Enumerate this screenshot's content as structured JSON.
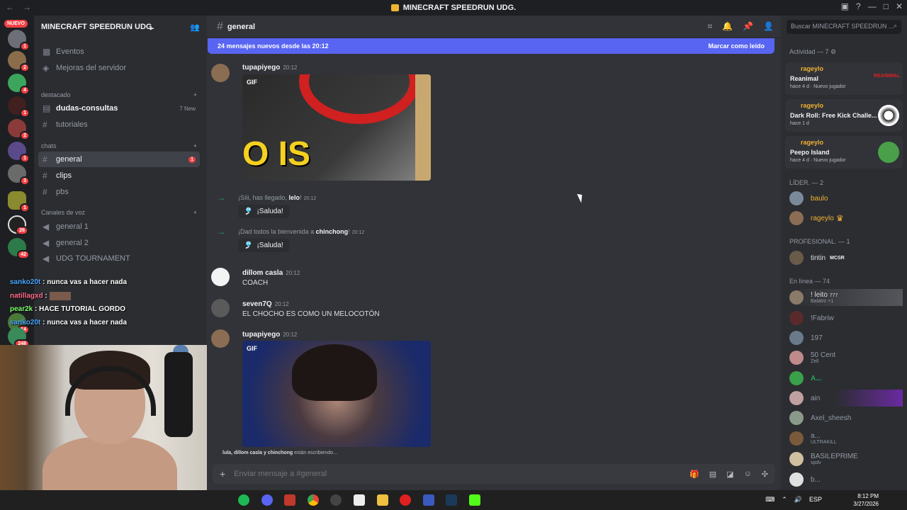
{
  "window": {
    "title": "MINECRAFT SPEEDRUN UDG.",
    "back": "←",
    "forward": "→"
  },
  "servers": {
    "nuevo": "NUEVO",
    "badges": [
      "1",
      "2",
      "4",
      "1",
      "2",
      "1",
      "3",
      "1",
      "26",
      "42",
      "14",
      "248"
    ]
  },
  "sidebar": {
    "server_name": "MINECRAFT SPEEDRUN UDG.",
    "items": [
      {
        "label": "Eventos"
      },
      {
        "label": "Mejoras del servidor"
      }
    ],
    "cat_destacado": "destacado",
    "destacado": [
      {
        "label": "dudas-consultas",
        "tag": "7 New"
      },
      {
        "label": "tutoriales"
      }
    ],
    "cat_chats": "chats",
    "chats": [
      {
        "label": "general",
        "badge": "1"
      },
      {
        "label": "clips"
      },
      {
        "label": "pbs"
      }
    ],
    "cat_voz": "Canales de voz",
    "voice": [
      {
        "label": "general 1"
      },
      {
        "label": "general 2"
      },
      {
        "label": "UDG TOURNAMENT"
      }
    ]
  },
  "twitch_chat": [
    {
      "user": "sanko20t",
      "text": ": nunca vas a hacer nada"
    },
    {
      "user": "natillagxd",
      "text": ":"
    },
    {
      "user": "pear2k",
      "text": ": HACE TUTORIAL GORDO"
    },
    {
      "user": "sanko20t",
      "text": ": nunca vas a hacer nada"
    }
  ],
  "chat": {
    "channel": "general",
    "banner_text": "24 mensajes nuevos desde las 20:12",
    "banner_action": "Marcar como leído",
    "messages": [
      {
        "author": "tupapiyego",
        "time": "20:12",
        "gif": "GIF",
        "gif_text": "O IS"
      },
      {
        "pre": "¡Síii, has llegado, ",
        "user": "lelo",
        "post": "!",
        "time": "20:12",
        "button": "¡Saluda!"
      },
      {
        "pre": "¡Dad todos la bienvenida a ",
        "user": "chinchong",
        "post": "!",
        "time": "20:12",
        "button": "¡Saluda!"
      },
      {
        "author": "dillom casla",
        "time": "20:12",
        "text": "COACH"
      },
      {
        "author": "seven7Q",
        "time": "20:12",
        "text": "EL CHOCHO ES COMO UN MELOCOTÓN"
      },
      {
        "author": "tupapiyego",
        "time": "20:12",
        "gif": "GIF"
      }
    ],
    "typing_users": "lula, dillom casla y chinchong",
    "typing_suffix": " están escribiendo...",
    "input_placeholder": "Enviar mensaje a #general"
  },
  "members": {
    "search_placeholder": "Buscar MINECRAFT SPEEDRUN ...",
    "activity_label": "Actividad — 7",
    "activities": [
      {
        "user": "rageylo",
        "game": "Reanimal",
        "meta": "hace 4 d · Nuevo jugador",
        "thumb_text": "REANIMAL"
      },
      {
        "user": "rageylo",
        "game": "Dark Roll: Free Kick Challe...",
        "meta": "hace 1 d"
      },
      {
        "user": "rageylo",
        "game": "Peepo Island",
        "meta": "hace 4 d · Nuevo jugador"
      }
    ],
    "lider_label": "LÍDER. — 2",
    "lider": [
      {
        "name": "baulo"
      },
      {
        "name": "rageylo"
      }
    ],
    "pro_label": "PROFESIONAL. — 1",
    "pro": [
      {
        "name": "tintin",
        "tag": "MCSR"
      }
    ],
    "online_label": "En línea — 74",
    "online": [
      {
        "name": "! leito",
        "tag": "777",
        "sub": "Balatro +1"
      },
      {
        "name": "!Fabriw"
      },
      {
        "name": "197"
      },
      {
        "name": "50 Cent",
        "sub": "Zell"
      },
      {
        "name": "A..."
      },
      {
        "name": "ain"
      },
      {
        "name": "Axel_sheesh"
      },
      {
        "name": "a...",
        "sub": "ULTRAKILL"
      },
      {
        "name": "BASILEPRIME",
        "sub": "spdv"
      },
      {
        "name": "b..."
      }
    ]
  },
  "taskbar": {
    "lang": "ESP",
    "time": "8:12 PM",
    "date": "3/27/2026"
  }
}
